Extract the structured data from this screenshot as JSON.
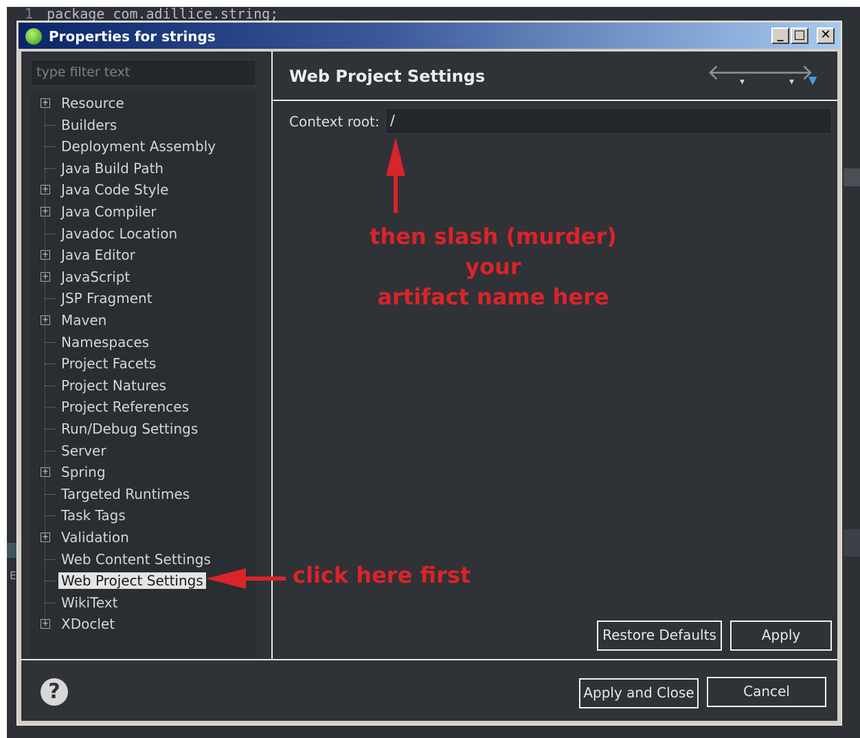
{
  "background_editor": {
    "line_number": "1",
    "code_text": "package com.adillice.string;"
  },
  "window": {
    "title": "Properties for strings",
    "controls": [
      "_",
      "□",
      "✕"
    ]
  },
  "filter": {
    "placeholder": "type filter text"
  },
  "tree": {
    "items": [
      {
        "label": "Resource",
        "expandable": true
      },
      {
        "label": "Builders",
        "expandable": false
      },
      {
        "label": "Deployment Assembly",
        "expandable": false
      },
      {
        "label": "Java Build Path",
        "expandable": false
      },
      {
        "label": "Java Code Style",
        "expandable": true
      },
      {
        "label": "Java Compiler",
        "expandable": true
      },
      {
        "label": "Javadoc Location",
        "expandable": false
      },
      {
        "label": "Java Editor",
        "expandable": true
      },
      {
        "label": "JavaScript",
        "expandable": true
      },
      {
        "label": "JSP Fragment",
        "expandable": false
      },
      {
        "label": "Maven",
        "expandable": true
      },
      {
        "label": "Namespaces",
        "expandable": false
      },
      {
        "label": "Project Facets",
        "expandable": false
      },
      {
        "label": "Project Natures",
        "expandable": false
      },
      {
        "label": "Project References",
        "expandable": false
      },
      {
        "label": "Run/Debug Settings",
        "expandable": false
      },
      {
        "label": "Server",
        "expandable": false
      },
      {
        "label": "Spring",
        "expandable": true
      },
      {
        "label": "Targeted Runtimes",
        "expandable": false
      },
      {
        "label": "Task Tags",
        "expandable": false
      },
      {
        "label": "Validation",
        "expandable": true
      },
      {
        "label": "Web Content Settings",
        "expandable": false
      },
      {
        "label": "Web Project Settings",
        "expandable": false,
        "selected": true
      },
      {
        "label": "WikiText",
        "expandable": false
      },
      {
        "label": "XDoclet",
        "expandable": true
      }
    ]
  },
  "page": {
    "title": "Web Project Settings",
    "context_root_label": "Context root:",
    "context_root_value": "/"
  },
  "buttons": {
    "restore_defaults": "Restore Defaults",
    "apply": "Apply",
    "apply_and_close": "Apply and Close",
    "cancel": "Cancel"
  },
  "annotations": {
    "slash_line1": "then slash (murder) your",
    "slash_line2": "artifact name here",
    "click_first": "click here first"
  },
  "colors": {
    "annotation": "#d9242a",
    "panel_bg": "#2f3236",
    "accent": "#3fa0e8"
  }
}
